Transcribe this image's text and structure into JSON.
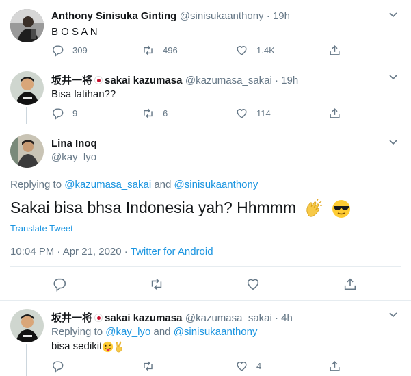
{
  "tweet1": {
    "display_name": "Anthony Sinisuka Ginting",
    "handle_time": "@sinisukaanthony · 19h",
    "text": "B O S A N",
    "replies": "309",
    "retweets": "496",
    "likes": "1.4K"
  },
  "tweet2": {
    "display_name_cjk": "坂井一将",
    "display_name": "sakai kazumasa",
    "handle_time": "@kazumasa_sakai · 19h",
    "text": "Bisa latihan??",
    "replies": "9",
    "retweets": "6",
    "likes": "114"
  },
  "main_tweet": {
    "display_name": "Lina Inoq",
    "handle": "@kay_lyo",
    "replying_prefix": "Replying to",
    "replying_user1": "@kazumasa_sakai",
    "replying_and": "and",
    "replying_user2": "@sinisukaanthony",
    "text": "Sakai bisa bhsa Indonesia yah? Hhmmm",
    "translate": "Translate Tweet",
    "timestamp": "10:04 PM · Apr 21, 2020 ·",
    "source": "Twitter for Android"
  },
  "tweet3": {
    "display_name_cjk": "坂井一将",
    "display_name": "sakai kazumasa",
    "handle_time": "@kazumasa_sakai · 4h",
    "replying_prefix": "Replying to",
    "replying_user1": "@kay_lyo",
    "replying_and": "and",
    "replying_user2": "@sinisukaanthony",
    "text": "bisa sedikit",
    "replies": "",
    "retweets": "",
    "likes": "4"
  },
  "colors": {
    "link": "#1b95e0",
    "muted": "#657786",
    "text": "#14171a",
    "line": "#ccd6dd"
  }
}
